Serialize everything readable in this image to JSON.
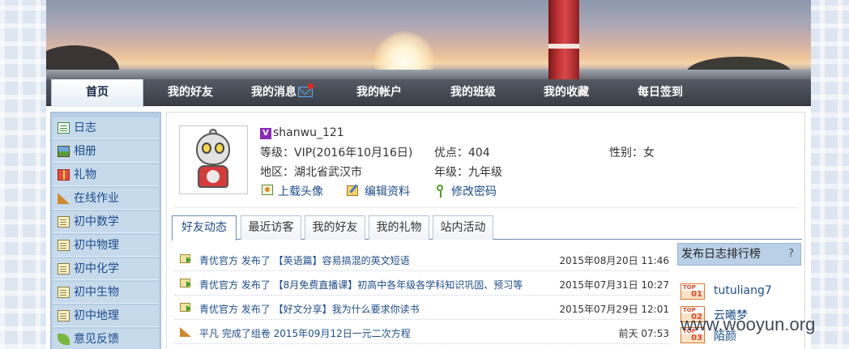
{
  "nav": {
    "items": [
      {
        "label": "首页",
        "active": true
      },
      {
        "label": "我的好友"
      },
      {
        "label": "我的消息",
        "icon": "mail-icon",
        "badge": "notification-dot"
      },
      {
        "label": "我的帐户"
      },
      {
        "label": "我的班级"
      },
      {
        "label": "我的收藏"
      },
      {
        "label": "每日签到"
      }
    ]
  },
  "sidebar": {
    "items": [
      {
        "label": "日志",
        "icon": "notebook-icon"
      },
      {
        "label": "相册",
        "icon": "photo-icon"
      },
      {
        "label": "礼物",
        "icon": "gift-icon"
      },
      {
        "label": "在线作业",
        "icon": "ruler-triangle-icon"
      },
      {
        "label": "初中数学",
        "icon": "book-icon"
      },
      {
        "label": "初中物理",
        "icon": "book-icon"
      },
      {
        "label": "初中化学",
        "icon": "book-icon"
      },
      {
        "label": "初中生物",
        "icon": "book-icon"
      },
      {
        "label": "初中地理",
        "icon": "book-icon"
      },
      {
        "label": "意见反馈",
        "icon": "leaf-icon"
      }
    ]
  },
  "profile": {
    "username": "shanwu_121",
    "vip_badge": "V",
    "level": "等级：VIP(2016年10月16日)",
    "points": "优点：404",
    "gender": "性别：女",
    "region": "地区：湖北省武汉市",
    "grade": "年级：九年级",
    "links": {
      "upload_avatar": "上载头像",
      "edit_profile": "编辑资料",
      "change_password": "修改密码"
    }
  },
  "tabs": [
    {
      "label": "好友动态",
      "active": true
    },
    {
      "label": "最近访客"
    },
    {
      "label": "我的好友"
    },
    {
      "label": "我的礼物"
    },
    {
      "label": "站内活动"
    }
  ],
  "feed": [
    {
      "text": "青优官方 发布了 【英语篇】容易搞混的英文短语",
      "time": "2015年08月20日 11:46",
      "icon": "document-arrow-icon"
    },
    {
      "text": "青优官方 发布了 【8月免费直播课】初高中各年级各学科知识巩固、预习等",
      "time": "2015年07月31日 10:27",
      "icon": "document-arrow-icon"
    },
    {
      "text": "青优官方 发布了 【好文分享】我为什么要求你读书",
      "time": "2015年07月29日 12:01",
      "icon": "document-arrow-icon"
    },
    {
      "text": "平凡 完成了组卷 2015年09月12日一元二次方程",
      "time": "前天 07:53",
      "icon": "ruler-triangle-icon"
    }
  ],
  "ranking": {
    "title": "发布日志排行榜",
    "help": "?",
    "top_label": "TOP",
    "items": [
      {
        "rank": "01",
        "name": "tutuliang7"
      },
      {
        "rank": "02",
        "name": "云曦梦"
      },
      {
        "rank": "03",
        "name": "陌颜"
      }
    ]
  },
  "watermark": "www.wooyun.org"
}
